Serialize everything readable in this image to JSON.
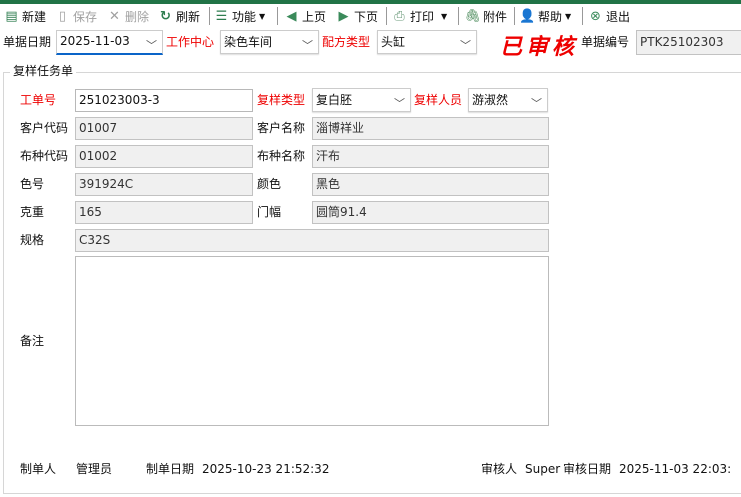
{
  "toolbar": {
    "new": "新建",
    "save": "保存",
    "delete": "删除",
    "refresh": "刷新",
    "function": "功能",
    "prev": "上页",
    "next": "下页",
    "print": "打印",
    "attach": "附件",
    "help": "帮助",
    "exit": "退出"
  },
  "header": {
    "date_label": "单据日期",
    "date_value": "2025-11-03",
    "center_label": "工作中心",
    "center_value": "染色车间",
    "recipe_label": "配方类型",
    "recipe_value": "头缸",
    "status_stamp": "已审核",
    "docno_label": "单据编号",
    "docno_value": "PTK25102303"
  },
  "form": {
    "title": "复样任务单",
    "order_label": "工单号",
    "order_value": "251023003-3",
    "type_label": "复样类型",
    "type_value": "复白胚",
    "staff_label": "复样人员",
    "staff_value": "游淑然",
    "cust_code_label": "客户代码",
    "cust_code_value": "01007",
    "cust_name_label": "客户名称",
    "cust_name_value": "淄博祥业",
    "cloth_code_label": "布种代码",
    "cloth_code_value": "01002",
    "cloth_name_label": "布种名称",
    "cloth_name_value": "汗布",
    "color_no_label": "色号",
    "color_no_value": "391924C",
    "color_label": "颜色",
    "color_value": "黑色",
    "weight_label": "克重",
    "weight_value": "165",
    "width_label": "门幅",
    "width_value": "圆筒91.4",
    "spec_label": "规格",
    "spec_value": "C32S",
    "remark_label": "备注",
    "remark_value": ""
  },
  "footer": {
    "creator_label": "制单人",
    "creator_value": "管理员",
    "created_label": "制单日期",
    "created_value": "2025-10-23 21:52:32",
    "auditor_label": "审核人",
    "auditor_value": "Super",
    "audited_label": "审核日期",
    "audited_value": "2025-11-03 22:03:"
  },
  "colors": {
    "accent": "#217346",
    "required": "#ee0000"
  }
}
